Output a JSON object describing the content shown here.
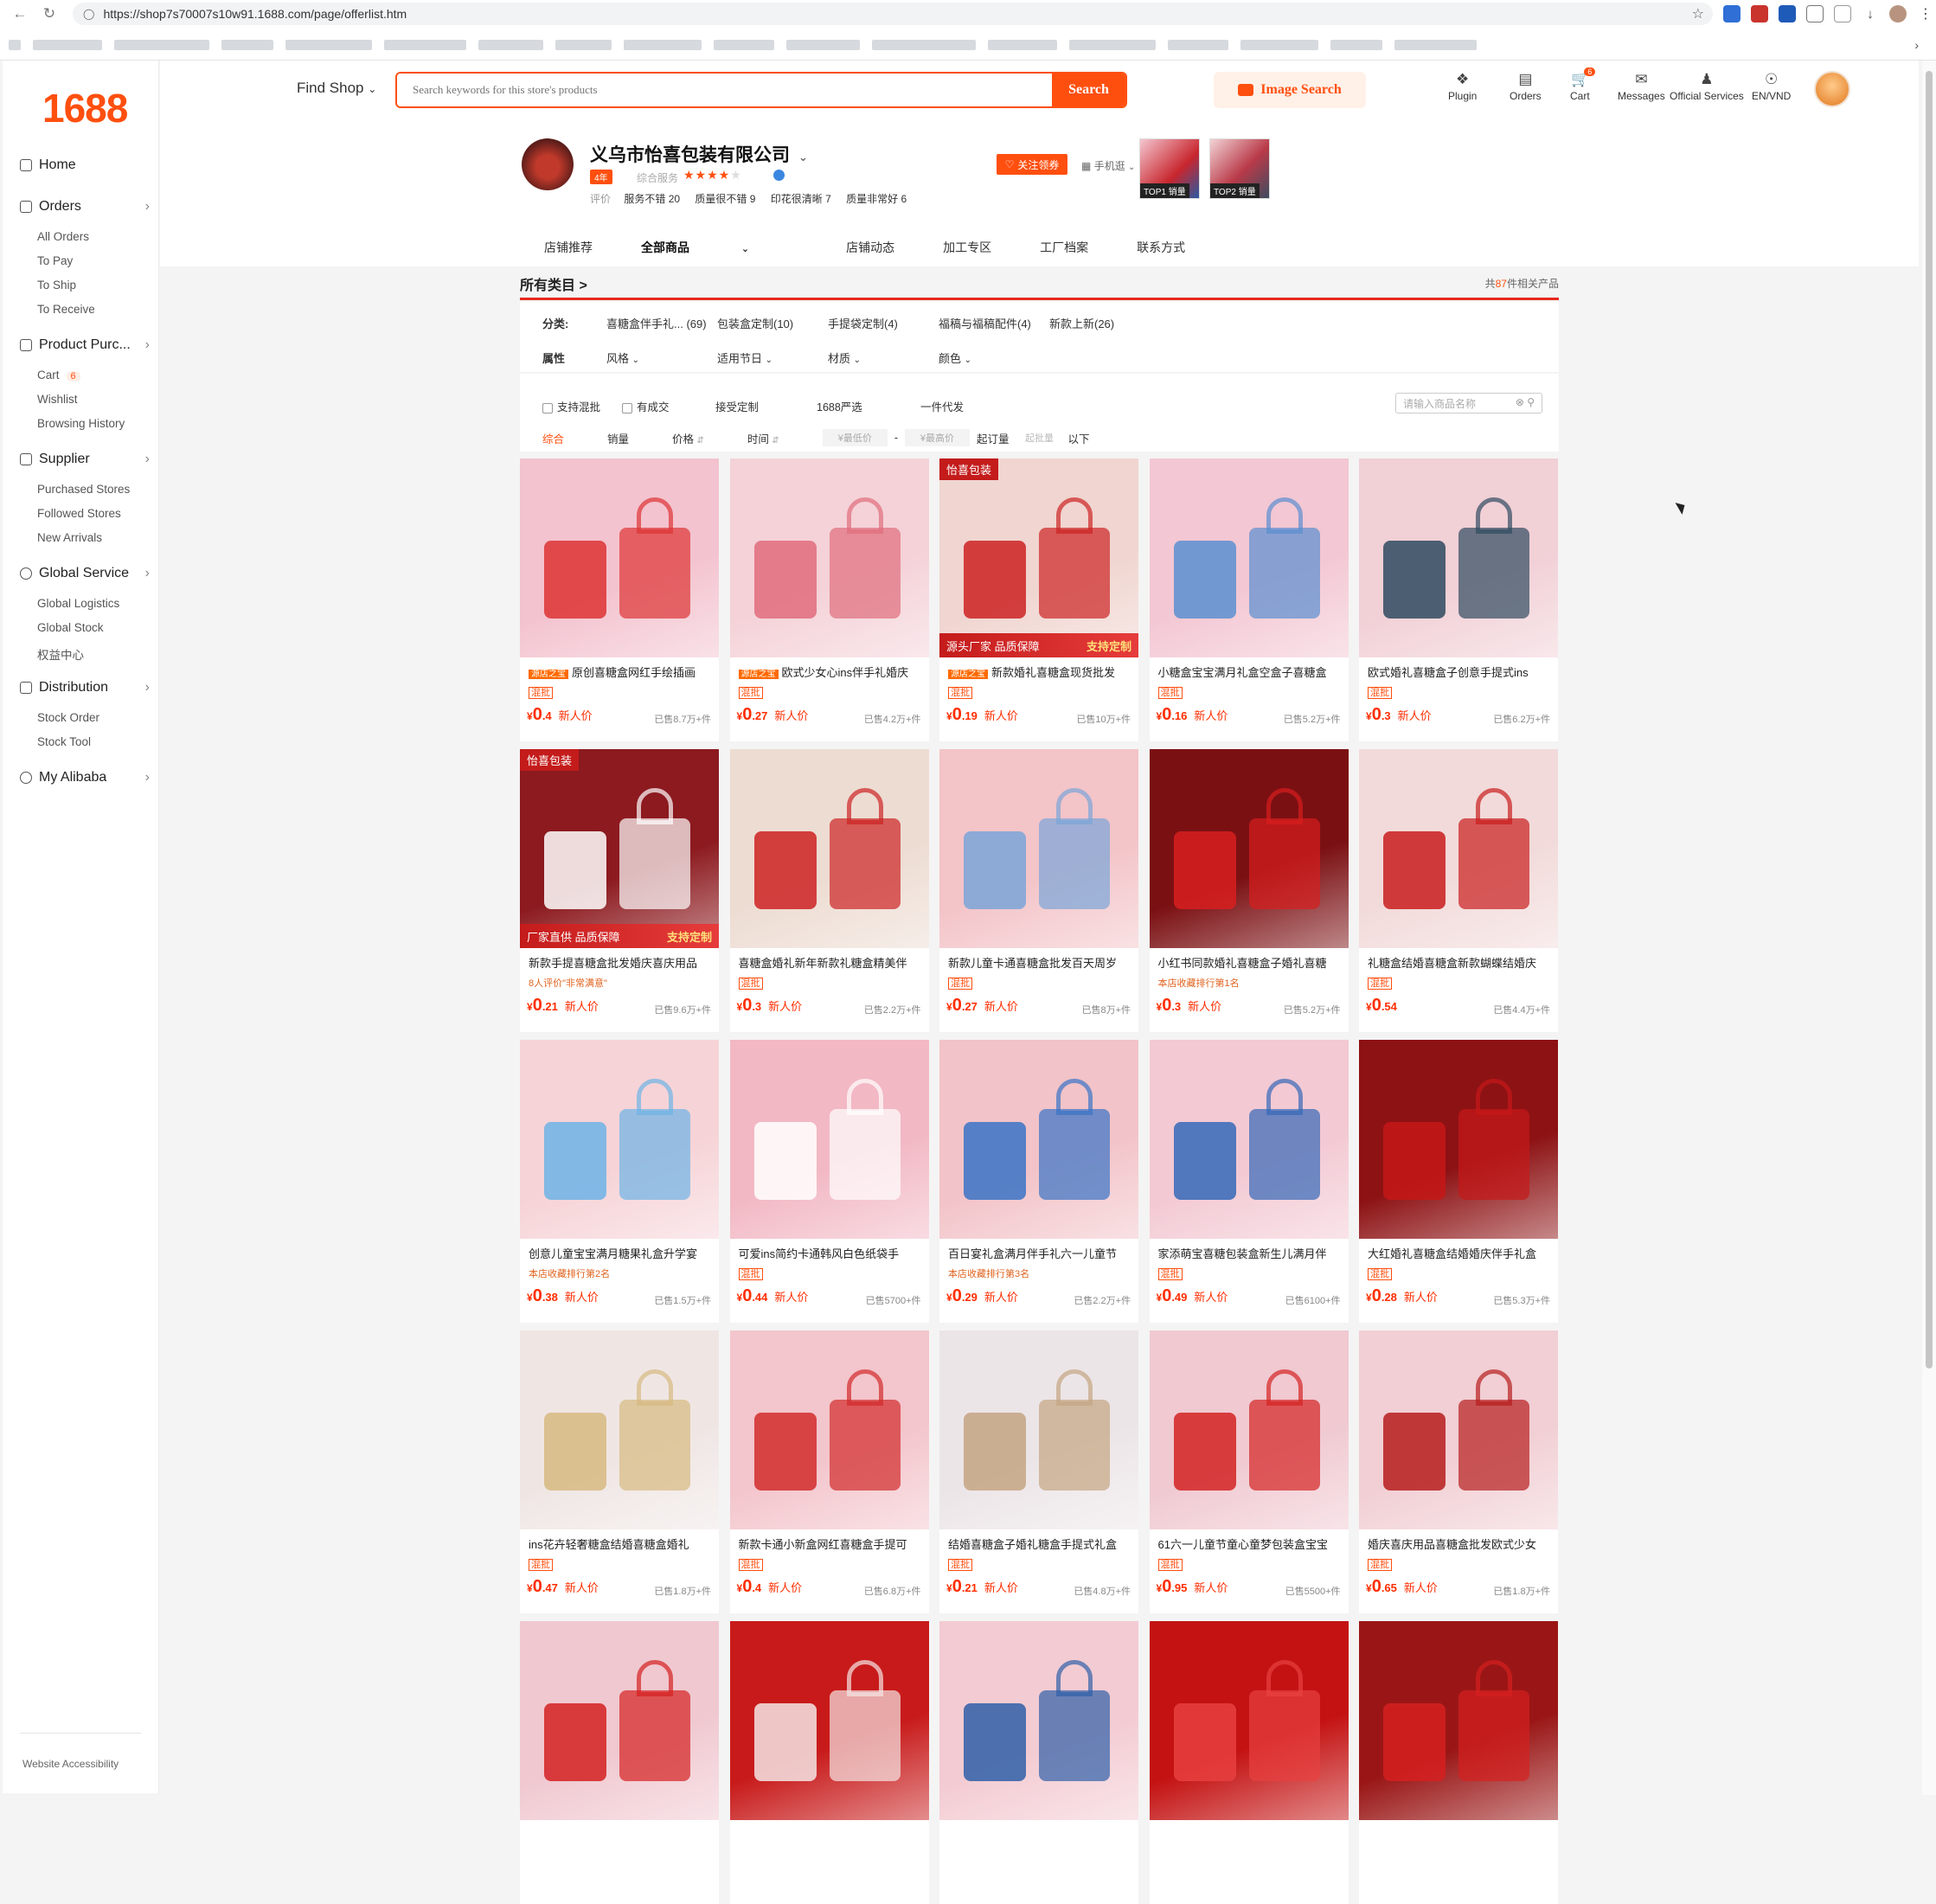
{
  "browser": {
    "url": "https://shop7s70007s10w91.1688.com/page/offerlist.htm"
  },
  "sidebar": {
    "logo": "1688",
    "home": "Home",
    "groups": [
      {
        "label": "Orders",
        "items": [
          "All Orders",
          "To Pay",
          "To Ship",
          "To Receive"
        ]
      },
      {
        "label": "Product Purc...",
        "items": [
          "Cart",
          "Wishlist",
          "Browsing History"
        ],
        "cart_count": "6"
      },
      {
        "label": "Supplier",
        "items": [
          "Purchased Stores",
          "Followed Stores",
          "New Arrivals"
        ]
      },
      {
        "label": "Global Service",
        "items": [
          "Global Logistics",
          "Global Stock",
          "权益中心"
        ]
      },
      {
        "label": "Distribution",
        "items": [
          "Stock Order",
          "Stock Tool"
        ]
      },
      {
        "label": "My Alibaba",
        "items": []
      }
    ],
    "footer": "Website Accessibility"
  },
  "topbar": {
    "find_shop": "Find Shop",
    "search_placeholder": "Search keywords for this store's products",
    "search_button": "Search",
    "image_search": "Image Search",
    "tools": {
      "plugin": "Plugin",
      "orders": "Orders",
      "cart": "Cart",
      "cart_badge": "6",
      "messages": "Messages",
      "official_services": "Official Services",
      "lang": "EN/VND"
    }
  },
  "shop": {
    "name": "义乌市怡喜包装有限公司",
    "year_badge": "4年",
    "rating_label": "综合服务",
    "stars": 4,
    "reviews_label": "评价",
    "reviews": [
      "服务不错 20",
      "质量很不错 9",
      "印花很清晰 7",
      "质量非常好 6"
    ],
    "follow_button": "关注领券",
    "mobile": "手机逛",
    "top_items": [
      "TOP1 销量",
      "TOP2 销量"
    ],
    "tabs": [
      "店铺推荐",
      "全部商品",
      "店铺动态",
      "加工专区",
      "工厂档案",
      "联系方式"
    ]
  },
  "listing": {
    "breadcrumb": "所有类目 >",
    "total_prefix": "共",
    "total_count": "87",
    "total_suffix": "件相关产品",
    "category_label": "分类:",
    "categories": [
      "喜糖盒伴手礼... (69)",
      "包装盒定制(10)",
      "手提袋定制(4)",
      "福稿与福稿配件(4)",
      "新款上新(26)"
    ],
    "attr_label": "属性",
    "attributes": [
      "风格",
      "适用节日",
      "材质",
      "颜色"
    ],
    "filters": [
      "支持混批",
      "有成交",
      "接受定制",
      "1688严选",
      "一件代发"
    ],
    "name_search_placeholder": "请输入商品名称",
    "sorts": [
      "综合",
      "销量",
      "价格",
      "时间"
    ],
    "min_price": "¥最低价",
    "max_price": "¥最高价",
    "moq_label": "起订量",
    "moq_placeholder": "起批量",
    "moq_suffix": "以下"
  },
  "products": [
    {
      "title": "原创喜糖盒网红手绘插画",
      "badge": "源店之宝",
      "sub": "混批",
      "int": "0",
      "dec": ".4",
      "np": "新人价",
      "sold": "已售8.7万+件",
      "color": "#f3c3cf",
      "accent": "#d33"
    },
    {
      "title": "欧式少女心ins伴手礼婚庆",
      "badge": "源店之宝",
      "sub": "混批",
      "int": "0",
      "dec": ".27",
      "np": "新人价",
      "sold": "已售4.2万+件",
      "color": "#f4d2d8",
      "accent": "#e06c7c"
    },
    {
      "title": "新款婚礼喜糖盒现货批发",
      "badge": "源店之宝",
      "sub": "混批",
      "int": "0",
      "dec": ".19",
      "np": "新人价",
      "sold": "已售10万+件",
      "color": "#f0d5d0",
      "accent": "#c22",
      "imgtag": "怡喜包装",
      "btag_left": "源头厂家 品质保障",
      "btag_right": "支持定制"
    },
    {
      "title": "小糖盒宝宝满月礼盒空盒子喜糖盒",
      "sub": "混批",
      "int": "0",
      "dec": ".16",
      "np": "新人价",
      "sold": "已售5.2万+件",
      "color": "#f3c7d3",
      "accent": "#5a8fd0"
    },
    {
      "title": "欧式婚礼喜糖盒子创意手提式ins",
      "sub": "混批",
      "int": "0",
      "dec": ".3",
      "np": "新人价",
      "sold": "已售6.2万+件",
      "color": "#f1d0d6",
      "accent": "#2f4a5f"
    },
    {
      "title": "新款手提喜糖盒批发婚庆喜庆用品",
      "sub": "8人评价\"非常满意\"",
      "subtype": "text",
      "int": "0",
      "dec": ".21",
      "np": "新人价",
      "sold": "已售9.6万+件",
      "color": "#8c1a1f",
      "accent": "#fff",
      "imgtag": "怡喜包装",
      "btag_left": "厂家直供 品质保障",
      "btag_right": "支持定制"
    },
    {
      "title": "喜糖盒婚礼新年新款礼糖盒精美伴",
      "sub": "混批",
      "int": "0",
      "dec": ".3",
      "np": "新人价",
      "sold": "已售2.2万+件",
      "color": "#eddcd2",
      "accent": "#c22"
    },
    {
      "title": "新款儿童卡通喜糖盒批发百天周岁",
      "sub": "混批",
      "int": "0",
      "dec": ".27",
      "np": "新人价",
      "sold": "已售8万+件",
      "color": "#f3c4c8",
      "accent": "#7aa5d8"
    },
    {
      "title": "小红书同款婚礼喜糖盒子婚礼喜糖",
      "sub": "本店收藏排行第1名",
      "subtype": "text",
      "int": "0",
      "dec": ".3",
      "np": "新人价",
      "sold": "已售5.2万+件",
      "color": "#7b1013",
      "accent": "#d81e1e"
    },
    {
      "title": "礼糖盒结婚喜糖盒新款蝴蝶结婚庆",
      "sub": "混批",
      "int": "0",
      "dec": ".54",
      "np": "",
      "sold": "已售4.4万+件",
      "color": "#f2dada",
      "accent": "#c91c1c"
    },
    {
      "title": "创意儿童宝宝满月糖果礼盒升学宴",
      "sub": "本店收藏排行第2名",
      "subtype": "text",
      "int": "0",
      "dec": ".38",
      "np": "新人价",
      "sold": "已售1.5万+件",
      "color": "#f6d3d7",
      "accent": "#6db3e6"
    },
    {
      "title": "可爱ins简约卡通韩风白色纸袋手",
      "sub": "混批",
      "int": "0",
      "dec": ".44",
      "np": "新人价",
      "sold": "已售5700+件",
      "color": "#f2b8c4",
      "accent": "#fff"
    },
    {
      "title": "百日宴礼盒满月伴手礼六一儿童节",
      "sub": "本店收藏排行第3名",
      "subtype": "text",
      "int": "0",
      "dec": ".29",
      "np": "新人价",
      "sold": "已售2.2万+件",
      "color": "#f2c3c8",
      "accent": "#3973c6"
    },
    {
      "title": "家添萌宝喜糖包装盒新生儿满月伴",
      "sub": "混批",
      "int": "0",
      "dec": ".49",
      "np": "新人价",
      "sold": "已售6100+件",
      "color": "#f3c9d3",
      "accent": "#3468b8"
    },
    {
      "title": "大红婚礼喜糖盒结婚婚庆伴手礼盒",
      "sub": "混批",
      "int": "0",
      "dec": ".28",
      "np": "新人价",
      "sold": "已售5.3万+件",
      "color": "#8d1214",
      "accent": "#c61818"
    },
    {
      "title": "ins花卉轻奢糖盒结婚喜糖盒婚礼",
      "sub": "混批",
      "int": "0",
      "dec": ".47",
      "np": "新人价",
      "sold": "已售1.8万+件",
      "color": "#efe6e4",
      "accent": "#d7b980"
    },
    {
      "title": "新款卡通小新盒网红喜糖盒手提可",
      "sub": "混批",
      "int": "0",
      "dec": ".4",
      "np": "新人价",
      "sold": "已售6.8万+件",
      "color": "#f3c5cc",
      "accent": "#d12a2a"
    },
    {
      "title": "结婚喜糖盒子婚礼糖盒手提式礼盒",
      "sub": "混批",
      "int": "0",
      "dec": ".21",
      "np": "新人价",
      "sold": "已售4.8万+件",
      "color": "#ece5e7",
      "accent": "#c4a582"
    },
    {
      "title": "61六一儿童节童心童梦包装盒宝宝",
      "sub": "混批",
      "int": "0",
      "dec": ".95",
      "np": "新人价",
      "sold": "已售5500+件",
      "color": "#f0c9d1",
      "accent": "#d42222"
    },
    {
      "title": "婚庆喜庆用品喜糖盒批发欧式少女",
      "sub": "混批",
      "int": "0",
      "dec": ".65",
      "np": "新人价",
      "sold": "已售1.8万+件",
      "color": "#f1cfd4",
      "accent": "#b71c1c"
    },
    {
      "title": "",
      "color": "#f0c8d0",
      "accent": "#d42020"
    },
    {
      "title": "",
      "color": "#c81a1a",
      "accent": "#f5e5e5"
    },
    {
      "title": "",
      "color": "#f3cbd2",
      "accent": "#2f5fa8"
    },
    {
      "title": "",
      "color": "#c41212",
      "accent": "#e84040"
    },
    {
      "title": "",
      "color": "#9a1616",
      "accent": "#d62020"
    }
  ]
}
